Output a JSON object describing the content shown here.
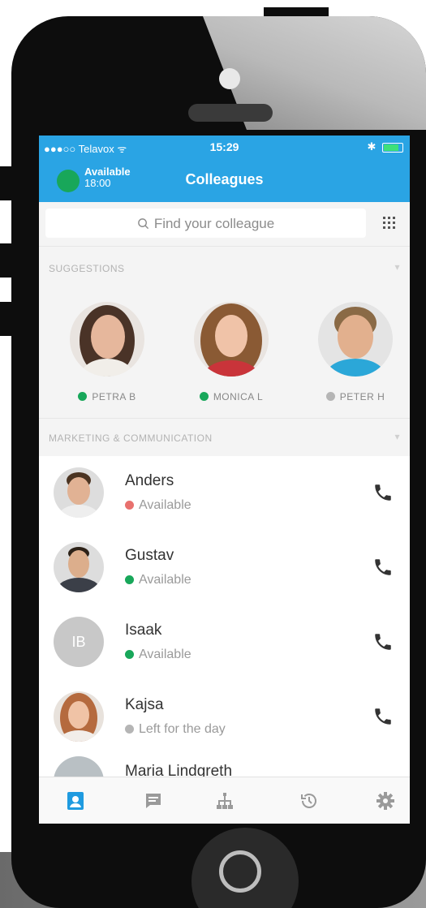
{
  "status_bar": {
    "carrier": "●●●○○ Telavox ᯤ",
    "time": "15:29",
    "right": "✱"
  },
  "nav": {
    "presence_label": "Available",
    "presence_time": "18:00",
    "title": "Colleagues"
  },
  "search": {
    "placeholder": "Find your colleague"
  },
  "sections": {
    "suggestions": "SUGGESTIONS",
    "group": "MARKETING & COMMUNICATION"
  },
  "suggestions": [
    {
      "name": "PETRA B",
      "status_color": "#18a75a"
    },
    {
      "name": "MONICA L",
      "status_color": "#18a75a"
    },
    {
      "name": "PETER H",
      "status_color": "#b5b5b5"
    }
  ],
  "contacts": [
    {
      "name": "Anders",
      "status": "Available",
      "status_color": "#e8716e"
    },
    {
      "name": "Gustav",
      "status": "Available",
      "status_color": "#18a75a"
    },
    {
      "name": "Isaak",
      "status": "Available",
      "status_color": "#18a75a",
      "initials": "IB"
    },
    {
      "name": "Kajsa",
      "status": "Left for the day",
      "status_color": "#b5b5b5"
    },
    {
      "name": "Maria Lindgreth"
    }
  ],
  "colors": {
    "accent": "#2aa4e4",
    "available": "#18a75a",
    "tab_active": "#1f9be0",
    "tab_inactive": "#9a9a9a"
  },
  "tabs": [
    {
      "icon": "contacts-icon",
      "active": true
    },
    {
      "icon": "chat-icon",
      "active": false
    },
    {
      "icon": "org-chart-icon",
      "active": false
    },
    {
      "icon": "history-icon",
      "active": false
    },
    {
      "icon": "settings-gear-icon",
      "active": false
    }
  ]
}
